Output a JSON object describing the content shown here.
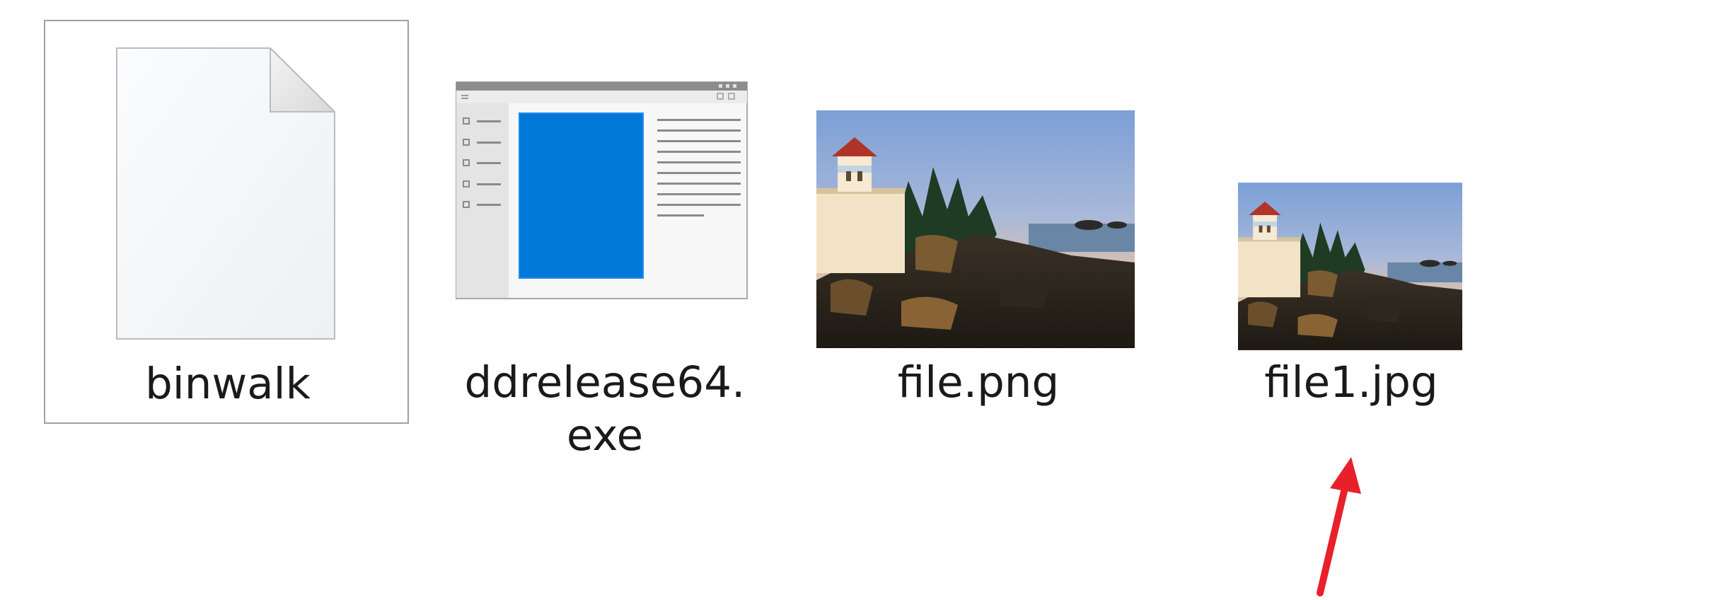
{
  "files": [
    {
      "name": "binwalk",
      "type": "generic-file-icon",
      "selected": true
    },
    {
      "name": "ddrelease64.exe",
      "type": "application-window-icon",
      "selected": false
    },
    {
      "name": "file.png",
      "type": "image-thumbnail",
      "selected": false
    },
    {
      "name": "file1.jpg",
      "type": "image-thumbnail",
      "selected": false
    }
  ],
  "annotation": {
    "type": "arrow",
    "color": "#e8202a",
    "points_to": "file1.jpg"
  }
}
